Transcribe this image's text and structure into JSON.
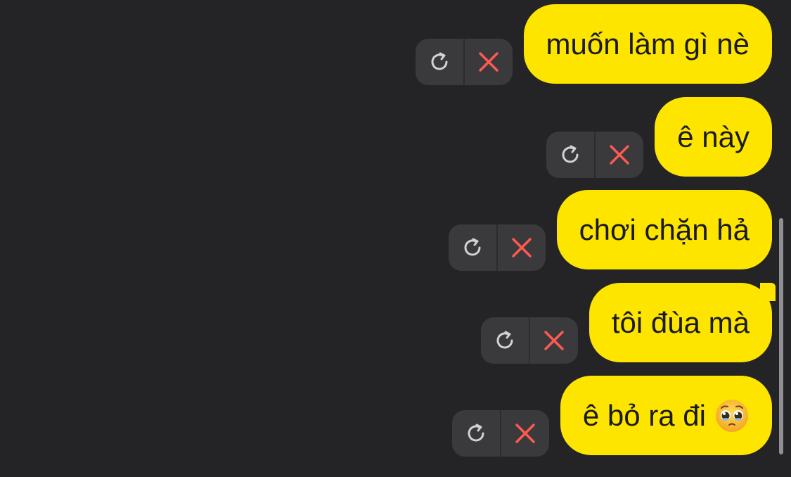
{
  "colors": {
    "background": "#242426",
    "bubble": "#FEE500",
    "action_bg": "#3a3a3c",
    "retry_icon": "#d1d1d6",
    "delete_icon": "#ff5a52"
  },
  "messages": [
    {
      "text": "muốn làm gì nè"
    },
    {
      "text": "ê này"
    },
    {
      "text": "chơi chặn hả"
    },
    {
      "text": "tôi đùa mà"
    },
    {
      "text": "ê bỏ ra đi",
      "emoji": "pleading-face-emoji"
    }
  ],
  "icons": {
    "retry": "retry-icon",
    "delete": "close-icon"
  }
}
